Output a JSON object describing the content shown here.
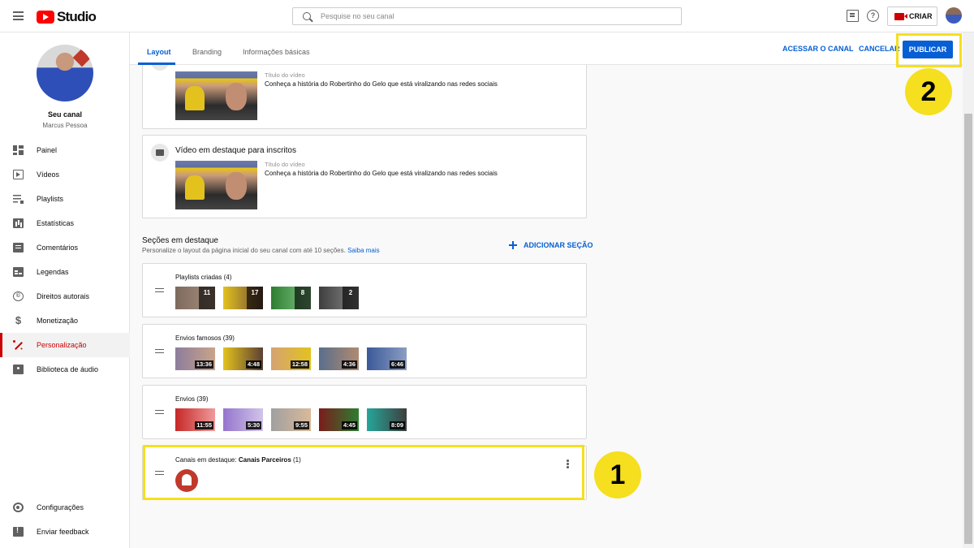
{
  "app": {
    "logo_text": "Studio",
    "search_placeholder": "Pesquise no seu canal",
    "create_label": "CRIAR",
    "help_glyph": "?"
  },
  "sidebar": {
    "channel_title": "Seu canal",
    "channel_name": "Marcus Pessoa",
    "items": [
      {
        "label": "Painel",
        "icon": "dashboard-icon"
      },
      {
        "label": "Vídeos",
        "icon": "videos-icon"
      },
      {
        "label": "Playlists",
        "icon": "playlists-icon"
      },
      {
        "label": "Estatísticas",
        "icon": "analytics-icon"
      },
      {
        "label": "Comentários",
        "icon": "comments-icon"
      },
      {
        "label": "Legendas",
        "icon": "subtitles-icon"
      },
      {
        "label": "Direitos autorais",
        "icon": "copyright-icon"
      },
      {
        "label": "Monetização",
        "icon": "dollar-icon"
      },
      {
        "label": "Personalização",
        "icon": "magic-wand-icon",
        "active": true
      },
      {
        "label": "Biblioteca de áudio",
        "icon": "audio-library-icon"
      }
    ],
    "bottom_items": [
      {
        "label": "Configurações",
        "icon": "gear-icon"
      },
      {
        "label": "Enviar feedback",
        "icon": "feedback-icon"
      }
    ],
    "copyright_glyph": "©",
    "dollar_glyph": "$"
  },
  "tabs": [
    {
      "label": "Layout",
      "active": true
    },
    {
      "label": "Branding"
    },
    {
      "label": "Informações básicas"
    }
  ],
  "actions": {
    "view_channel": "ACESSAR O CANAL",
    "cancel": "CANCELAR",
    "publish": "PUBLICAR"
  },
  "markers": {
    "one": "1",
    "two": "2"
  },
  "video_cards": [
    {
      "title": "",
      "meta_label": "Título do vídeo",
      "meta_value": "Conheça a história do Robertinho do Gelo que está viralizando nas redes sociais"
    },
    {
      "title": "Vídeo em destaque para inscritos",
      "meta_label": "Título do vídeo",
      "meta_value": "Conheça a história do Robertinho do Gelo que está viralizando nas redes sociais"
    }
  ],
  "sections": {
    "title": "Seções em destaque",
    "description": "Personalize o layout da página inicial do seu canal com até 10 seções.",
    "learn_more": "Saiba mais",
    "add_label": "ADICIONAR SEÇÃO",
    "rows": [
      {
        "title": "Playlists criadas",
        "count": "(4)",
        "thumbs": [
          "11",
          "17",
          "8",
          "2"
        ],
        "kind": "playlist"
      },
      {
        "title": "Envios famosos",
        "count": "(39)",
        "thumbs": [
          "13:36",
          "4:48",
          "12:58",
          "4:36",
          "6:46"
        ],
        "kind": "video"
      },
      {
        "title": "Envios",
        "count": "(39)",
        "thumbs": [
          "11:55",
          "5:30",
          "9:55",
          "4:45",
          "8:09"
        ],
        "kind": "video"
      }
    ],
    "featured_channels": {
      "prefix": "Canais em destaque:",
      "name": "Canais Parceiros",
      "count": "(1)"
    }
  },
  "colors": {
    "accent": "#065fd4",
    "brand_red": "#ff0000",
    "highlight": "#f5df1e"
  }
}
